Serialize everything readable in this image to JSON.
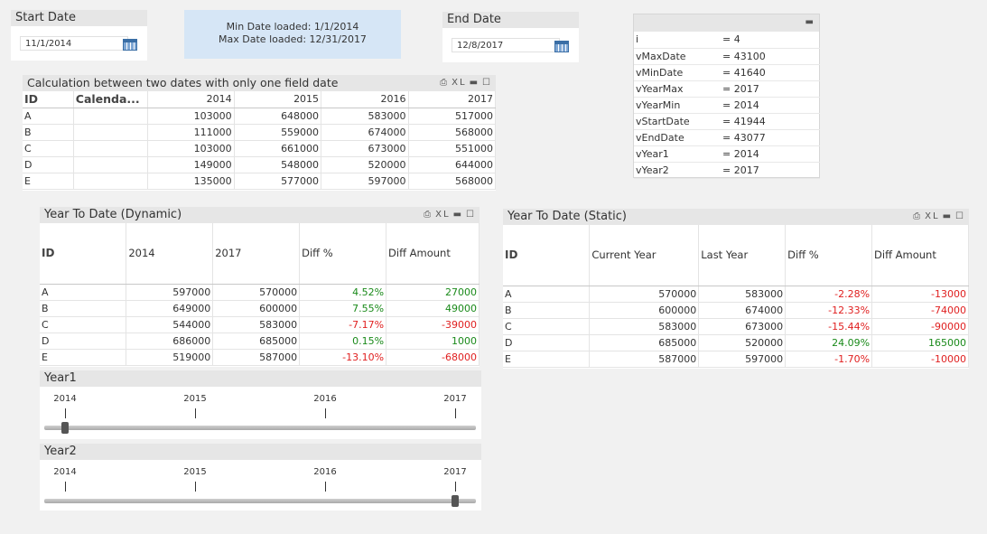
{
  "start_date": {
    "title": "Start Date",
    "value": "11/1/2014"
  },
  "end_date": {
    "title": "End Date",
    "value": "12/8/2017"
  },
  "info_box": {
    "line1": "Min Date loaded: 1/1/2014",
    "line2": "Max Date loaded: 12/31/2017"
  },
  "variables": {
    "rows": [
      {
        "name": "i",
        "value": "= 4"
      },
      {
        "name": "vMaxDate",
        "value": "= 43100"
      },
      {
        "name": "vMinDate",
        "value": "= 41640"
      },
      {
        "name": "vYearMax",
        "value": "= 2017"
      },
      {
        "name": "vYearMin",
        "value": "= 2014"
      },
      {
        "name": "vStartDate",
        "value": "= 41944"
      },
      {
        "name": "vEndDate",
        "value": "= 43077"
      },
      {
        "name": "vYear1",
        "value": "= 2014"
      },
      {
        "name": "vYear2",
        "value": "= 2017"
      }
    ]
  },
  "calc_table": {
    "title": "Calculation between two dates with only one field date",
    "icons": {
      "print": "print-icon",
      "xl": "XL",
      "minimize": "minimize-icon",
      "maximize": "maximize-icon"
    },
    "headers": [
      "ID",
      "Calenda...",
      "2014",
      "2015",
      "2016",
      "2017"
    ],
    "rows": [
      [
        "A",
        "",
        "103000",
        "648000",
        "583000",
        "517000"
      ],
      [
        "B",
        "",
        "111000",
        "559000",
        "674000",
        "568000"
      ],
      [
        "C",
        "",
        "103000",
        "661000",
        "673000",
        "551000"
      ],
      [
        "D",
        "",
        "149000",
        "548000",
        "520000",
        "644000"
      ],
      [
        "E",
        "",
        "135000",
        "577000",
        "597000",
        "568000"
      ]
    ]
  },
  "ytd_dynamic": {
    "title": "Year To Date (Dynamic)",
    "headers": [
      "ID",
      "2014",
      "2017",
      "Diff %",
      "Diff Amount"
    ],
    "rows": [
      [
        "A",
        "597000",
        "570000",
        "4.52%",
        "27000"
      ],
      [
        "B",
        "649000",
        "600000",
        "7.55%",
        "49000"
      ],
      [
        "C",
        "544000",
        "583000",
        "-7.17%",
        "-39000"
      ],
      [
        "D",
        "686000",
        "685000",
        "0.15%",
        "1000"
      ],
      [
        "E",
        "519000",
        "587000",
        "-13.10%",
        "-68000"
      ]
    ]
  },
  "ytd_static": {
    "title": "Year To Date (Static)",
    "headers": [
      "ID",
      "Current Year",
      "Last Year",
      "Diff %",
      "Diff Amount"
    ],
    "rows": [
      [
        "A",
        "570000",
        "583000",
        "-2.28%",
        "-13000"
      ],
      [
        "B",
        "600000",
        "674000",
        "-12.33%",
        "-74000"
      ],
      [
        "C",
        "583000",
        "673000",
        "-15.44%",
        "-90000"
      ],
      [
        "D",
        "685000",
        "520000",
        "24.09%",
        "165000"
      ],
      [
        "E",
        "587000",
        "597000",
        "-1.70%",
        "-10000"
      ]
    ]
  },
  "year1": {
    "title": "Year1",
    "ticks": [
      "2014",
      "2015",
      "2016",
      "2017"
    ],
    "selected_index": 0
  },
  "year2": {
    "title": "Year2",
    "ticks": [
      "2014",
      "2015",
      "2016",
      "2017"
    ],
    "selected_index": 3
  },
  "colors": {
    "positive": "#1a8a1a",
    "negative": "#e02020",
    "info_bg": "#d6e6f6",
    "caption_bg": "#e6e6e6"
  }
}
